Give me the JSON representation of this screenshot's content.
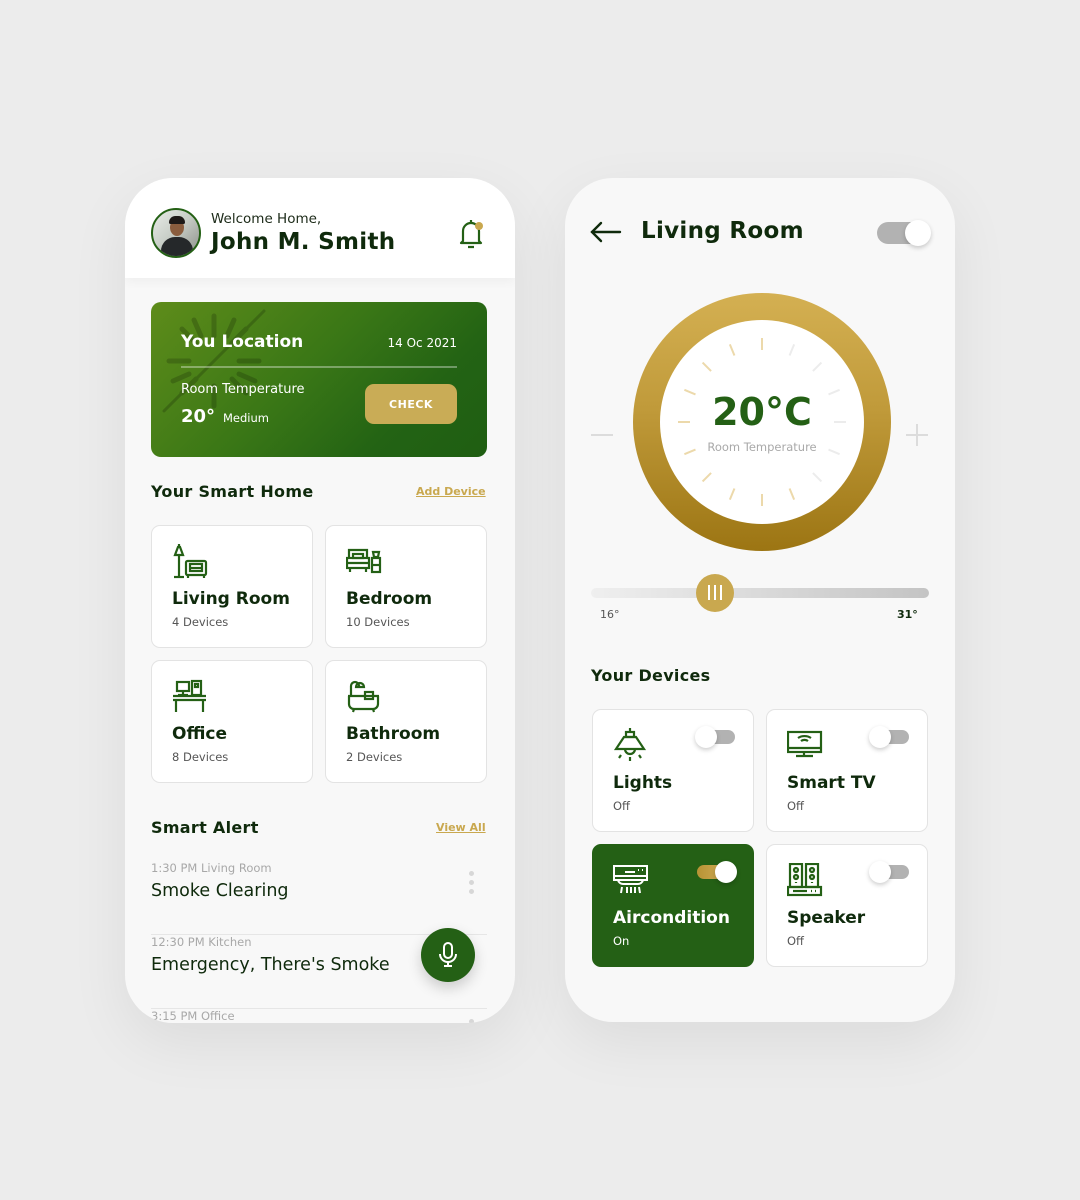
{
  "home": {
    "header": {
      "greeting": "Welcome Home,",
      "user_name": "John M. Smith",
      "notification_icon": "bell-icon",
      "has_notification": true
    },
    "location_card": {
      "title": "You Location",
      "date": "14 Oc 2021",
      "temp_label": "Room Temperature",
      "temp_value": "20°",
      "temp_level": "Medium",
      "check_label": "CHECK"
    },
    "smart_home": {
      "title": "Your Smart Home",
      "add_label": "Add Device",
      "rooms": [
        {
          "name": "Living Room",
          "count": "4 Devices",
          "icon": "living-room-icon"
        },
        {
          "name": "Bedroom",
          "count": "10 Devices",
          "icon": "bedroom-icon"
        },
        {
          "name": "Office",
          "count": "8 Devices",
          "icon": "office-icon"
        },
        {
          "name": "Bathroom",
          "count": "2 Devices",
          "icon": "bathroom-icon"
        }
      ]
    },
    "alerts": {
      "title": "Smart Alert",
      "view_all_label": "View All",
      "items": [
        {
          "meta": "1:30 PM Living Room",
          "text": "Smoke Clearing"
        },
        {
          "meta": "12:30 PM Kitchen",
          "text": "Emergency, There's Smoke"
        },
        {
          "meta": "3:15 PM Office",
          "text": ""
        }
      ]
    },
    "fab": {
      "icon": "microphone-icon"
    }
  },
  "room": {
    "title": "Living Room",
    "power_on": true,
    "thermostat": {
      "value": "20°C",
      "label": "Room Temperature",
      "decrease_icon": "minus-icon",
      "increase_icon": "plus-icon"
    },
    "slider": {
      "min_label": "16°",
      "max_label": "31°",
      "min": 16,
      "max": 31,
      "value": 21.5
    },
    "devices": {
      "title": "Your Devices",
      "items": [
        {
          "name": "Lights",
          "state": "Off",
          "on": false,
          "icon": "ceiling-lamp-icon"
        },
        {
          "name": "Smart TV",
          "state": "Off",
          "on": false,
          "icon": "smart-tv-icon"
        },
        {
          "name": "Aircondition",
          "state": "On",
          "on": true,
          "icon": "air-conditioner-icon"
        },
        {
          "name": "Speaker",
          "state": "Off",
          "on": false,
          "icon": "speaker-icon"
        }
      ]
    }
  },
  "colors": {
    "primary_green": "#246015",
    "accent_gold": "#c9a84f",
    "text_dark": "#0f2a0c",
    "background": "#ececec"
  }
}
